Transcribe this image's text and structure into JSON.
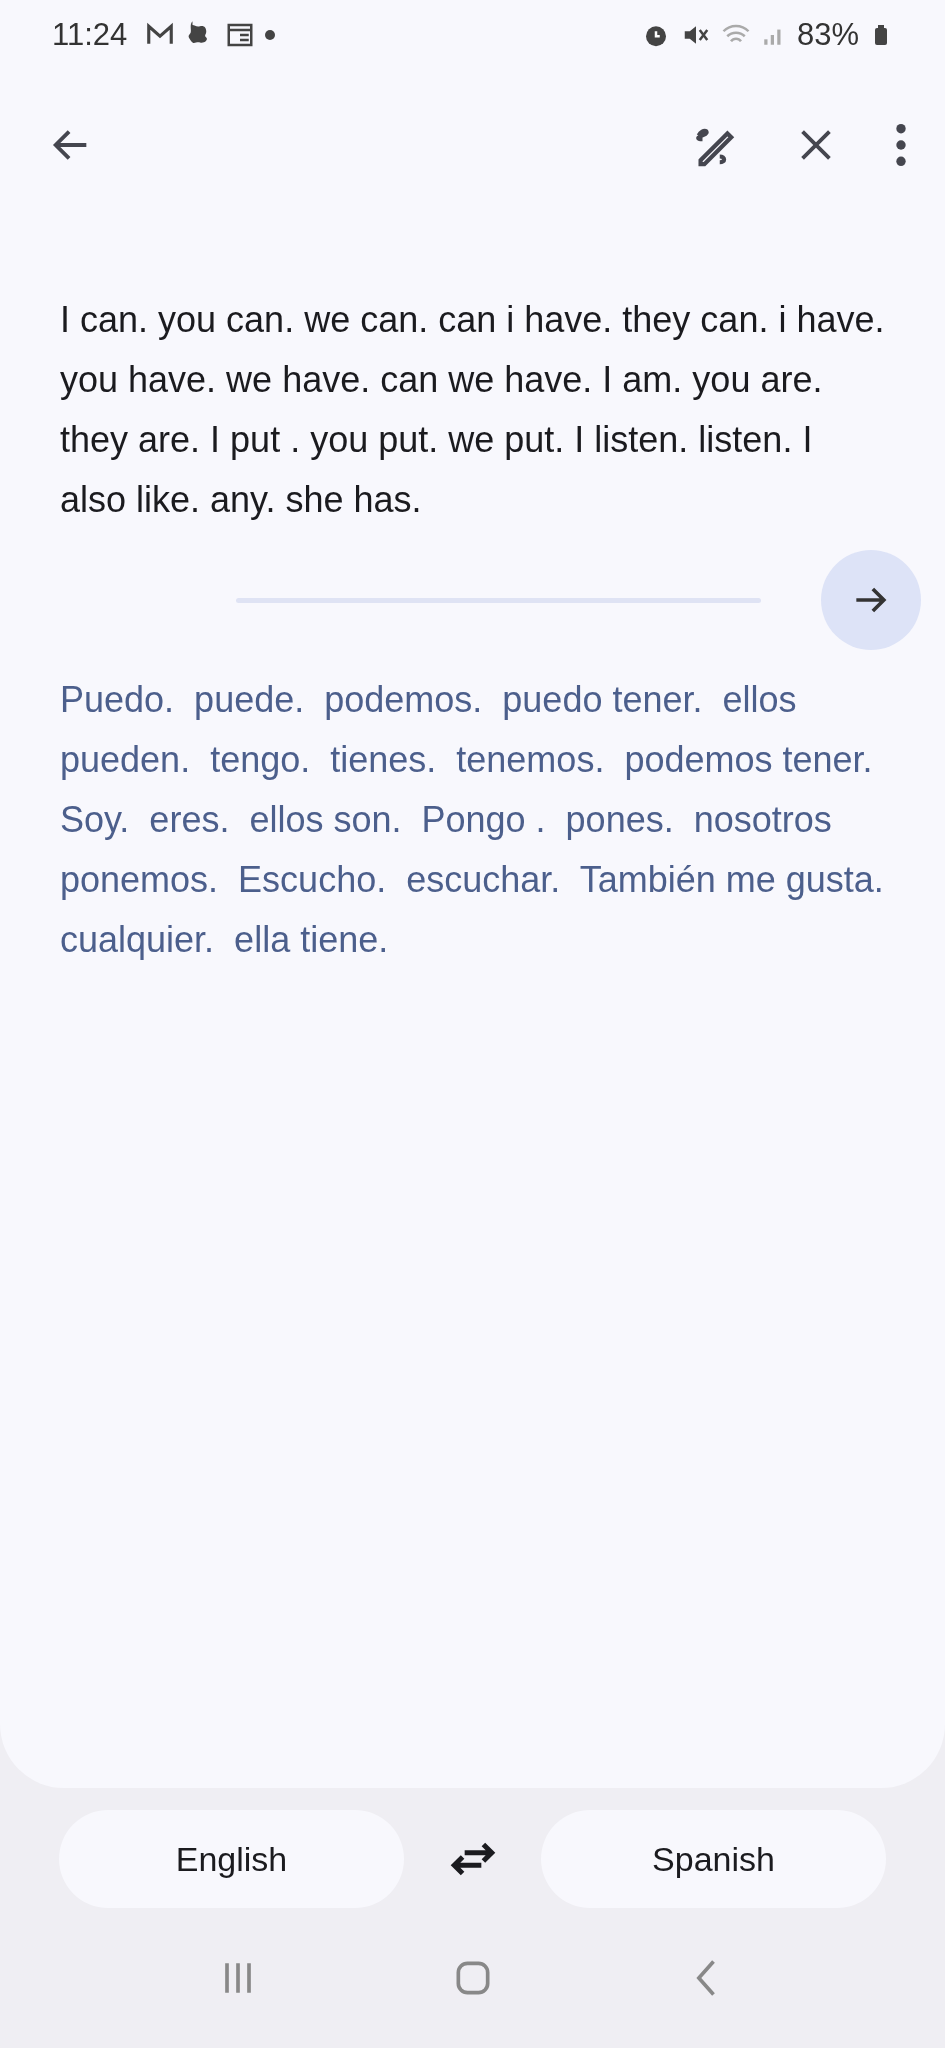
{
  "status_bar": {
    "time": "11:24",
    "battery": "83%"
  },
  "source_text": "I can. you can. we can. can i have. they can. i have. you have. we have. can we have. I am. you are.  they are. I put . you put. we put. I listen. listen. I also like. any. she has.",
  "translation": "Puedo.  puede.  podemos.  puedo tener.  ellos pueden.  tengo.  tienes.  tenemos.  podemos tener.  Soy.  eres.  ellos son.  Pongo .  pones.  nosotros ponemos.  Escucho.  escuchar.  También me gusta.  cualquier.  ella tiene.",
  "languages": {
    "source": "English",
    "target": "Spanish"
  }
}
